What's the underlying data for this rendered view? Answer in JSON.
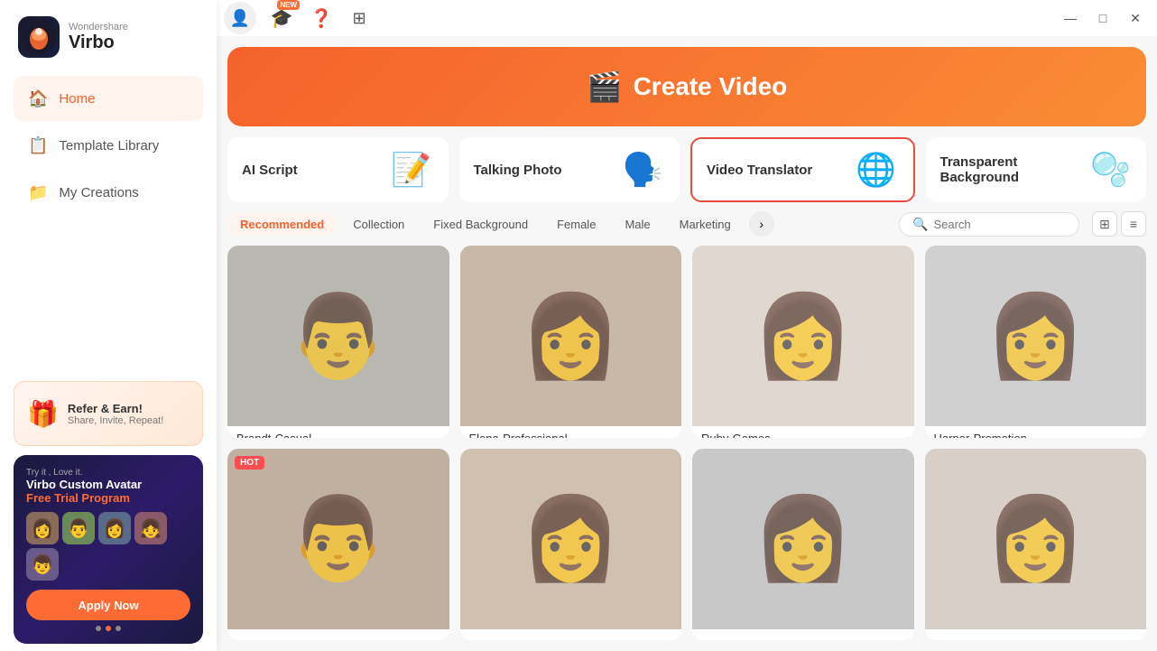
{
  "app": {
    "brand": "Wondershare",
    "name": "Virbo"
  },
  "sidebar": {
    "nav": [
      {
        "id": "home",
        "label": "Home",
        "icon": "🏠",
        "active": true
      },
      {
        "id": "template-library",
        "label": "Template Library",
        "icon": "📋",
        "active": false
      },
      {
        "id": "my-creations",
        "label": "My Creations",
        "icon": "📁",
        "active": false
      }
    ],
    "refer": {
      "title": "Refer & Earn!",
      "subtitle": "Share, Invite, Repeat!",
      "icon": "🎁"
    },
    "promo": {
      "try": "Try it , Love it.",
      "title1": "Virbo Custom Avatar",
      "title2": "Free Trial Program",
      "apply_btn": "Apply Now"
    }
  },
  "hero": {
    "icon": "➕",
    "title": "Create Video"
  },
  "features": [
    {
      "id": "ai-script",
      "label": "AI Script",
      "icon": "📝",
      "selected": false
    },
    {
      "id": "talking-photo",
      "label": "Talking Photo",
      "icon": "🗣️",
      "selected": false
    },
    {
      "id": "video-translator",
      "label": "Video Translator",
      "icon": "🌐",
      "selected": true
    },
    {
      "id": "transparent-bg",
      "label": "Transparent Background",
      "icon": "🫧",
      "selected": false
    }
  ],
  "filters": {
    "tabs": [
      {
        "id": "recommended",
        "label": "Recommended",
        "active": true
      },
      {
        "id": "collection",
        "label": "Collection",
        "active": false
      },
      {
        "id": "fixed-bg",
        "label": "Fixed Background",
        "active": false
      },
      {
        "id": "female",
        "label": "Female",
        "active": false
      },
      {
        "id": "male",
        "label": "Male",
        "active": false
      },
      {
        "id": "marketing",
        "label": "Marketing",
        "active": false
      }
    ],
    "search_placeholder": "Search"
  },
  "avatars": [
    {
      "id": 1,
      "name": "Brandt-Casual",
      "bg": "#b8b8b8",
      "hot": false,
      "emoji": "👨"
    },
    {
      "id": 2,
      "name": "Elena-Professional",
      "bg": "#c8b8a8",
      "hot": false,
      "emoji": "👩"
    },
    {
      "id": 3,
      "name": "Ruby-Games",
      "bg": "#e0d8d0",
      "hot": false,
      "emoji": "👩"
    },
    {
      "id": 4,
      "name": "Harper-Promotion",
      "bg": "#d0d0d0",
      "hot": false,
      "emoji": "👩"
    },
    {
      "id": 5,
      "name": "",
      "bg": "#c0b0a0",
      "hot": true,
      "emoji": "👨"
    },
    {
      "id": 6,
      "name": "",
      "bg": "#d0c0b0",
      "hot": false,
      "emoji": "👩"
    },
    {
      "id": 7,
      "name": "",
      "bg": "#c8c8c8",
      "hot": false,
      "emoji": "👩"
    },
    {
      "id": 8,
      "name": "",
      "bg": "#d8d0c8",
      "hot": false,
      "emoji": "👩"
    }
  ],
  "titlebar": {
    "minimize": "—",
    "maximize": "□",
    "close": "✕"
  }
}
